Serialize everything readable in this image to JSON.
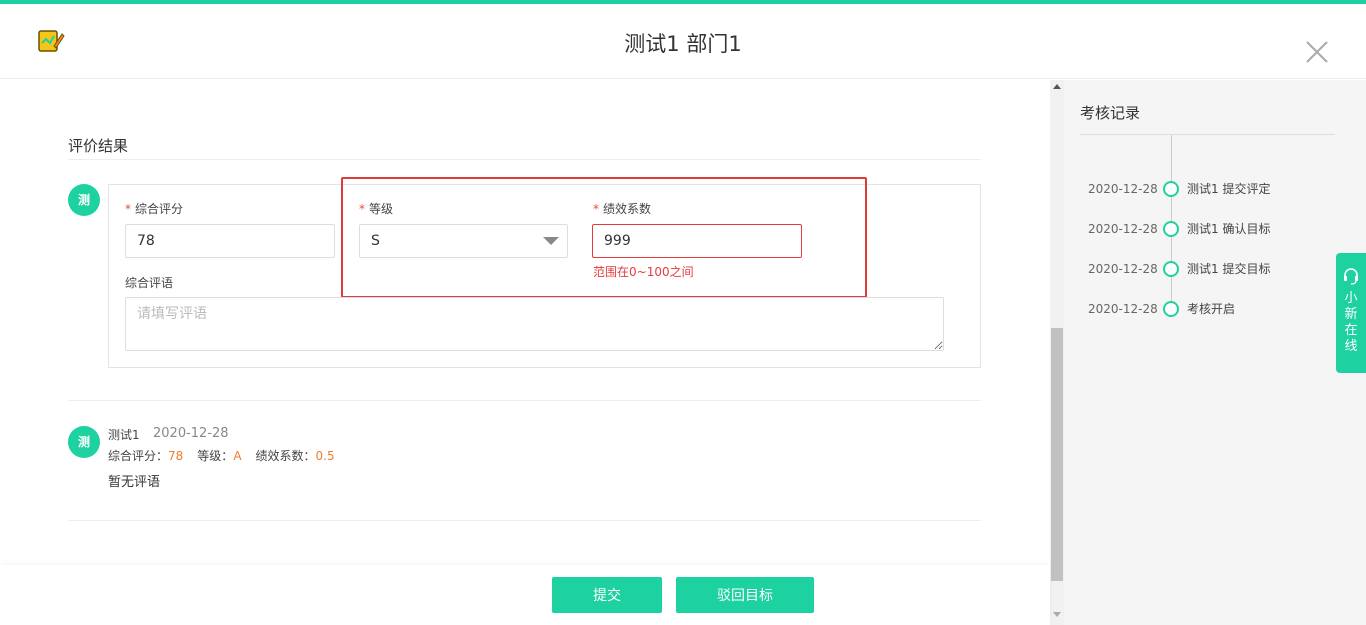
{
  "header": {
    "title": "测试1 部门1",
    "logo_icon": "clipboard-edit-icon",
    "close_icon": "close-icon"
  },
  "section": {
    "title": "评价结果"
  },
  "form": {
    "avatar_text": "测",
    "score_label": "综合评分",
    "score_value": "78",
    "grade_label": "等级",
    "grade_value": "S",
    "coefficient_label": "绩效系数",
    "coefficient_value": "999",
    "coefficient_error": "范围在0~100之间",
    "comment_label": "综合评语",
    "comment_placeholder": "请填写评语",
    "required_mark": "*"
  },
  "record": {
    "avatar_text": "测",
    "name": "测试1",
    "date": "2020-12-28",
    "score_label": "综合评分：",
    "score_value": "78",
    "grade_label": "等级：",
    "grade_value": "A",
    "coefficient_label": "绩效系数：",
    "coefficient_value": "0.5",
    "comment": "暂无评语"
  },
  "side": {
    "title": "考核记录",
    "timeline": [
      {
        "date": "2020-12-28",
        "text": "测试1 提交评定"
      },
      {
        "date": "2020-12-28",
        "text": "测试1 确认目标"
      },
      {
        "date": "2020-12-28",
        "text": "测试1 提交目标"
      },
      {
        "date": "2020-12-28",
        "text": "考核开启"
      }
    ]
  },
  "chat": {
    "label": "小新在线",
    "icon": "headset-icon"
  },
  "footer": {
    "submit_label": "提交",
    "reject_label": "驳回目标"
  },
  "colors": {
    "accent": "#1ed1a1",
    "error": "#e43c3c",
    "highlight": "#f07e2c"
  }
}
